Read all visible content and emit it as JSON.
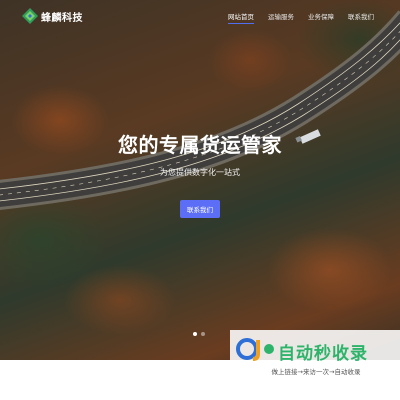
{
  "header": {
    "logo_text": "蜂麟科技",
    "nav": [
      {
        "label": "网站首页",
        "active": true
      },
      {
        "label": "运输服务",
        "active": false
      },
      {
        "label": "业务保障",
        "active": false
      },
      {
        "label": "联系我们",
        "active": false
      }
    ]
  },
  "hero": {
    "headline": "您的专属货运管家",
    "subline": "为您提供数字化一站式",
    "cta_label": "联系我们",
    "slides_total": 2,
    "slide_active": 1
  },
  "watermark": {
    "title": "自动秒收录",
    "subtitle": "做上链接→来访一次→自动收录"
  },
  "colors": {
    "accent": "#5b6ef5",
    "nav_underline": "#4f6ef0",
    "watermark_green": "#2db46a"
  }
}
